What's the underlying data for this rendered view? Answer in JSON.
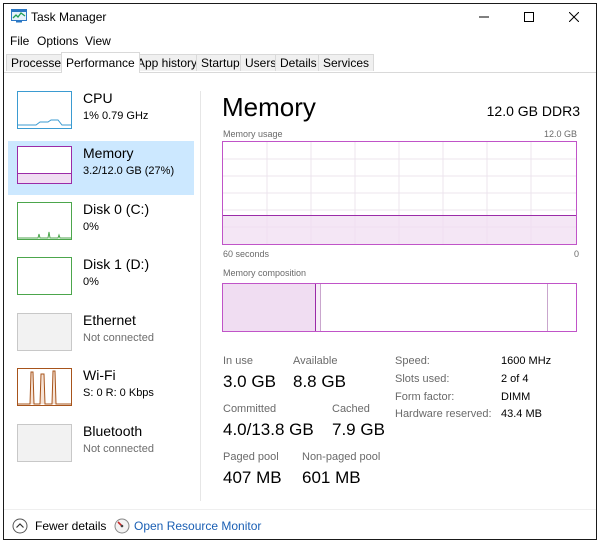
{
  "window": {
    "title": "Task Manager"
  },
  "menu": [
    "File",
    "Options",
    "View"
  ],
  "tabs": [
    "Processes",
    "Performance",
    "App history",
    "Startup",
    "Users",
    "Details",
    "Services"
  ],
  "active_tab": "Performance",
  "sidebar": [
    {
      "name": "CPU",
      "sub": "1%  0.79 GHz",
      "color": "#3b9bd1",
      "selected": false
    },
    {
      "name": "Memory",
      "sub": "3.2/12.0 GB (27%)",
      "color": "#9b2ba8",
      "selected": true
    },
    {
      "name": "Disk 0 (C:)",
      "sub": "0%",
      "color": "#4ca64c",
      "selected": false
    },
    {
      "name": "Disk 1 (D:)",
      "sub": "0%",
      "color": "#4ca64c",
      "selected": false
    },
    {
      "name": "Ethernet",
      "sub": "Not connected",
      "color": "#c8c8c8",
      "selected": false
    },
    {
      "name": "Wi-Fi",
      "sub": "S: 0 R: 0 Kbps",
      "color": "#a7541b",
      "selected": false
    },
    {
      "name": "Bluetooth",
      "sub": "Not connected",
      "color": "#c8c8c8",
      "selected": false
    }
  ],
  "main": {
    "title": "Memory",
    "spec": "12.0 GB DDR3",
    "usage_label": "Memory usage",
    "usage_max": "12.0 GB",
    "time_left": "60 seconds",
    "time_right": "0",
    "composition_label": "Memory composition",
    "usage_fraction": 0.27
  },
  "stats": {
    "in_use_label": "In use",
    "in_use": "3.0 GB",
    "available_label": "Available",
    "available": "8.8 GB",
    "committed_label": "Committed",
    "committed": "4.0/13.8 GB",
    "cached_label": "Cached",
    "cached": "7.9 GB",
    "paged_label": "Paged pool",
    "paged": "407 MB",
    "nonpaged_label": "Non-paged pool",
    "nonpaged": "601 MB"
  },
  "specs": [
    {
      "label": "Speed:",
      "value": "1600 MHz"
    },
    {
      "label": "Slots used:",
      "value": "2 of 4"
    },
    {
      "label": "Form factor:",
      "value": "DIMM"
    },
    {
      "label": "Hardware reserved:",
      "value": "43.4 MB"
    }
  ],
  "footer": {
    "fewer": "Fewer details",
    "monitor": "Open Resource Monitor"
  },
  "colors": {
    "memory": "#9b2ba8",
    "memory_fill": "#f0ddf2",
    "selected_bg": "#cce8ff"
  }
}
